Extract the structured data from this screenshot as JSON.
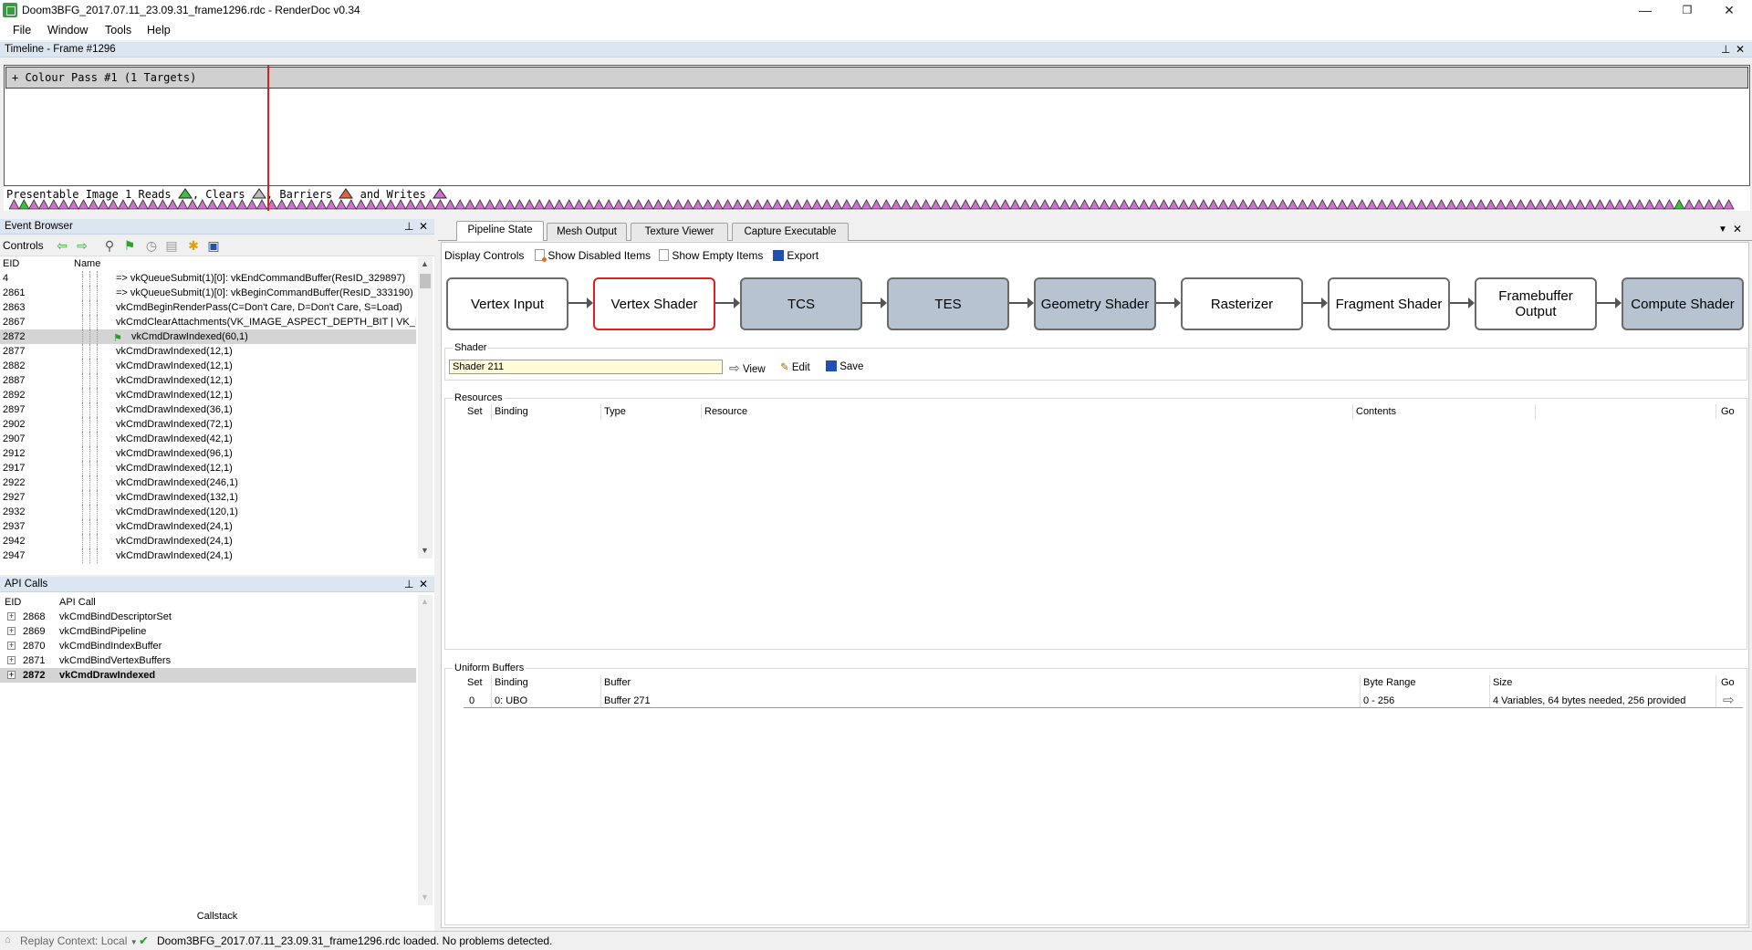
{
  "window": {
    "title": "Doom3BFG_2017.07.11_23.09.31_frame1296.rdc - RenderDoc v0.34",
    "minimize": "—",
    "restore": "❐",
    "close": "✕"
  },
  "menu": [
    "File",
    "Window",
    "Tools",
    "Help"
  ],
  "timeline": {
    "header": "Timeline - Frame #1296",
    "colour_pass": "+ Colour Pass #1 (1 Targets)",
    "presentable_prefix": "Presentable Image 1 Reads",
    "clears": ", Clears",
    "barriers": ", Barriers",
    "and_writes": " and Writes"
  },
  "event_browser": {
    "header": "Event Browser",
    "controls_label": "Controls",
    "col_eid": "EID",
    "col_name": "Name",
    "rows": [
      {
        "eid": "4",
        "name": "=> vkQueueSubmit(1)[0]: vkEndCommandBuffer(ResID_329897)"
      },
      {
        "eid": "2861",
        "name": "=> vkQueueSubmit(1)[0]: vkBeginCommandBuffer(ResID_333190)"
      },
      {
        "eid": "2863",
        "name": "vkCmdBeginRenderPass(C=Don't Care, D=Don't Care, S=Load)"
      },
      {
        "eid": "2867",
        "name": "vkCmdClearAttachments(VK_IMAGE_ASPECT_DEPTH_BIT | VK_I..."
      },
      {
        "eid": "2872",
        "name": "vkCmdDrawIndexed(60,1)"
      },
      {
        "eid": "2877",
        "name": "vkCmdDrawIndexed(12,1)"
      },
      {
        "eid": "2882",
        "name": "vkCmdDrawIndexed(12,1)"
      },
      {
        "eid": "2887",
        "name": "vkCmdDrawIndexed(12,1)"
      },
      {
        "eid": "2892",
        "name": "vkCmdDrawIndexed(12,1)"
      },
      {
        "eid": "2897",
        "name": "vkCmdDrawIndexed(36,1)"
      },
      {
        "eid": "2902",
        "name": "vkCmdDrawIndexed(72,1)"
      },
      {
        "eid": "2907",
        "name": "vkCmdDrawIndexed(42,1)"
      },
      {
        "eid": "2912",
        "name": "vkCmdDrawIndexed(96,1)"
      },
      {
        "eid": "2917",
        "name": "vkCmdDrawIndexed(12,1)"
      },
      {
        "eid": "2922",
        "name": "vkCmdDrawIndexed(246,1)"
      },
      {
        "eid": "2927",
        "name": "vkCmdDrawIndexed(132,1)"
      },
      {
        "eid": "2932",
        "name": "vkCmdDrawIndexed(120,1)"
      },
      {
        "eid": "2937",
        "name": "vkCmdDrawIndexed(24,1)"
      },
      {
        "eid": "2942",
        "name": "vkCmdDrawIndexed(24,1)"
      },
      {
        "eid": "2947",
        "name": "vkCmdDrawIndexed(24,1)"
      }
    ],
    "selected_eid": "2872"
  },
  "api_calls": {
    "header": "API Calls",
    "col_eid": "EID",
    "col_call": "API Call",
    "rows": [
      {
        "eid": "2868",
        "call": "vkCmdBindDescriptorSet"
      },
      {
        "eid": "2869",
        "call": "vkCmdBindPipeline"
      },
      {
        "eid": "2870",
        "call": "vkCmdBindIndexBuffer"
      },
      {
        "eid": "2871",
        "call": "vkCmdBindVertexBuffers"
      },
      {
        "eid": "2872",
        "call": "vkCmdDrawIndexed"
      }
    ],
    "callstack": "Callstack"
  },
  "tabs": [
    "Pipeline State",
    "Mesh Output",
    "Texture Viewer",
    "Capture Executable"
  ],
  "pipeline": {
    "display_controls": "Display Controls",
    "show_disabled": "Show Disabled Items",
    "show_empty": "Show Empty Items",
    "export": "Export",
    "stages": [
      {
        "label": "Vertex Input",
        "state": "white"
      },
      {
        "label": "Vertex Shader",
        "state": "selected"
      },
      {
        "label": "TCS",
        "state": "grey"
      },
      {
        "label": "TES",
        "state": "grey"
      },
      {
        "label": "Geometry Shader",
        "state": "grey"
      },
      {
        "label": "Rasterizer",
        "state": "white"
      },
      {
        "label": "Fragment Shader",
        "state": "white"
      },
      {
        "label": "Framebuffer Output",
        "state": "white"
      },
      {
        "label": "Compute Shader",
        "state": "grey"
      }
    ],
    "shader_group": "Shader",
    "shader_value": "Shader 211",
    "view": "View",
    "edit": "Edit",
    "save": "Save",
    "resources_group": "Resources",
    "resources_cols": [
      "Set",
      "Binding",
      "Type",
      "Resource",
      "Contents",
      "Go"
    ],
    "ubo_group": "Uniform Buffers",
    "ubo_cols": [
      "Set",
      "Binding",
      "Buffer",
      "Byte Range",
      "Size",
      "Go"
    ],
    "ubo_rows": [
      {
        "set": "0",
        "binding": "0: UBO",
        "buffer": "Buffer 271",
        "range": "0 - 256",
        "size": "4 Variables, 64 bytes needed, 256 provided"
      }
    ]
  },
  "status": {
    "replay_context": "Replay Context: Local",
    "message": "Doom3BFG_2017.07.11_23.09.31_frame1296.rdc loaded. No problems detected."
  },
  "colors": {
    "selected_stage_border": "#e02020",
    "disabled_stage": "#b8c3d1",
    "panel_header": "#dce6f1",
    "marker": "#e02020"
  }
}
